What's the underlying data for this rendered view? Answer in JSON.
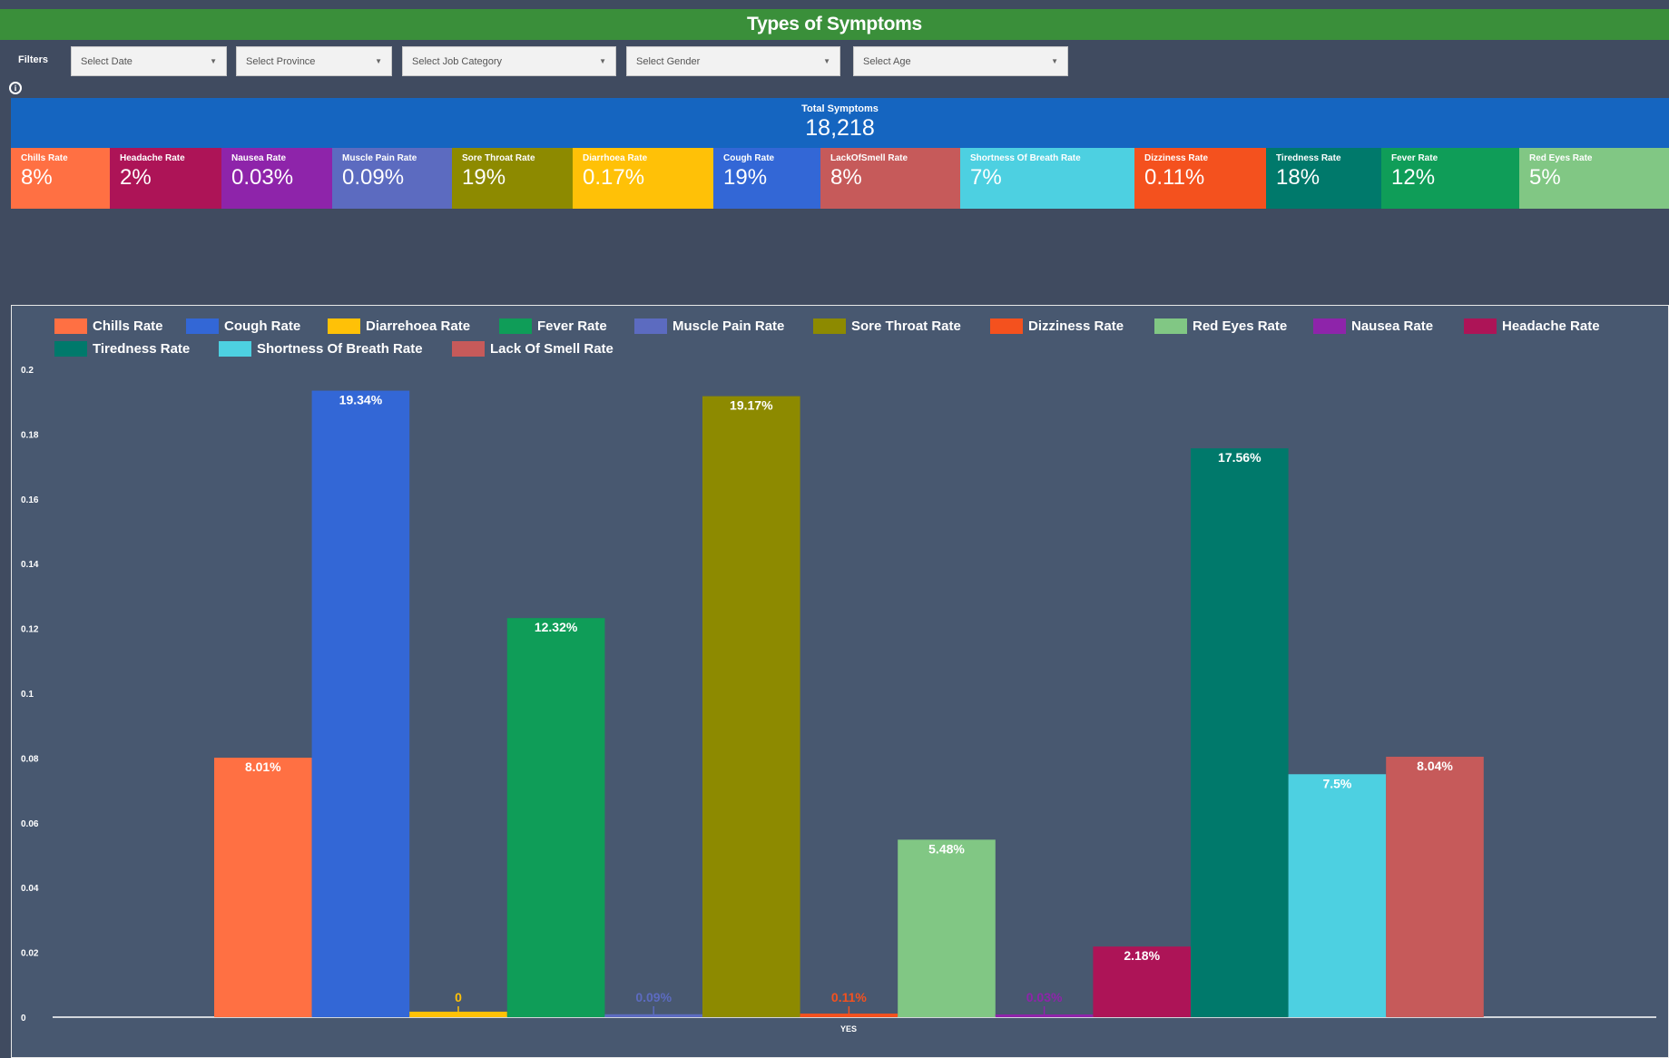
{
  "title": "Types of Symptoms",
  "filters": {
    "label": "Filters",
    "items": [
      {
        "placeholder": "Select Date"
      },
      {
        "placeholder": "Select Province"
      },
      {
        "placeholder": "Select Job Category"
      },
      {
        "placeholder": "Select Gender"
      },
      {
        "placeholder": "Select Age"
      }
    ]
  },
  "total": {
    "label": "Total Symptoms",
    "value": "18,218"
  },
  "kpis": [
    {
      "label": "Chills Rate",
      "value": "8%",
      "color": "#ff7043"
    },
    {
      "label": "Headache Rate",
      "value": "2%",
      "color": "#ad1457"
    },
    {
      "label": "Nausea Rate",
      "value": "0.03%",
      "color": "#8e24aa"
    },
    {
      "label": "Muscle Pain Rate",
      "value": "0.09%",
      "color": "#5c6bc0"
    },
    {
      "label": "Sore Throat Rate",
      "value": "19%",
      "color": "#8d8a00"
    },
    {
      "label": "Diarrhoea Rate",
      "value": "0.17%",
      "color": "#ffc107"
    },
    {
      "label": "Cough Rate",
      "value": "19%",
      "color": "#3367d6"
    },
    {
      "label": "LackOfSmell Rate",
      "value": "8%",
      "color": "#c65a5a"
    },
    {
      "label": "Shortness Of Breath Rate",
      "value": "7%",
      "color": "#4dd0e1"
    },
    {
      "label": "Dizziness Rate",
      "value": "0.11%",
      "color": "#f4511e"
    },
    {
      "label": "Tiredness Rate",
      "value": "18%",
      "color": "#00796b"
    },
    {
      "label": "Fever Rate",
      "value": "12%",
      "color": "#0f9d58"
    },
    {
      "label": "Red Eyes Rate",
      "value": "5%",
      "color": "#81c784"
    }
  ],
  "chart_data": {
    "type": "bar",
    "categories": [
      "YES"
    ],
    "ylim": [
      0,
      0.2
    ],
    "yticks": [
      "0",
      "0.02",
      "0.04",
      "0.06",
      "0.08",
      "0.1",
      "0.12",
      "0.14",
      "0.16",
      "0.18",
      "0.2"
    ],
    "legend_position": "top",
    "series": [
      {
        "name": "Chills Rate",
        "value": 0.0801,
        "label": "8.01%",
        "color": "#ff7043"
      },
      {
        "name": "Cough Rate",
        "value": 0.1934,
        "label": "19.34%",
        "color": "#3367d6"
      },
      {
        "name": "Diarrehoea Rate",
        "value": 0.0017,
        "label": "0",
        "color": "#ffc107"
      },
      {
        "name": "Fever Rate",
        "value": 0.1232,
        "label": "12.32%",
        "color": "#0f9d58"
      },
      {
        "name": "Muscle Pain Rate",
        "value": 0.0009,
        "label": "0.09%",
        "color": "#5c6bc0"
      },
      {
        "name": "Sore Throat Rate",
        "value": 0.1917,
        "label": "19.17%",
        "color": "#8d8a00"
      },
      {
        "name": "Dizziness Rate",
        "value": 0.0011,
        "label": "0.11%",
        "color": "#f4511e"
      },
      {
        "name": "Red Eyes Rate",
        "value": 0.0548,
        "label": "5.48%",
        "color": "#81c784"
      },
      {
        "name": "Nausea Rate",
        "value": 0.0003,
        "label": "0.03%",
        "color": "#8e24aa"
      },
      {
        "name": "Headache Rate",
        "value": 0.0218,
        "label": "2.18%",
        "color": "#ad1457"
      },
      {
        "name": "Tiredness Rate",
        "value": 0.1756,
        "label": "17.56%",
        "color": "#00796b"
      },
      {
        "name": "Shortness Of Breath Rate",
        "value": 0.075,
        "label": "7.5%",
        "color": "#4dd0e1"
      },
      {
        "name": "Lack Of Smell Rate",
        "value": 0.0804,
        "label": "8.04%",
        "color": "#c65a5a"
      }
    ]
  }
}
